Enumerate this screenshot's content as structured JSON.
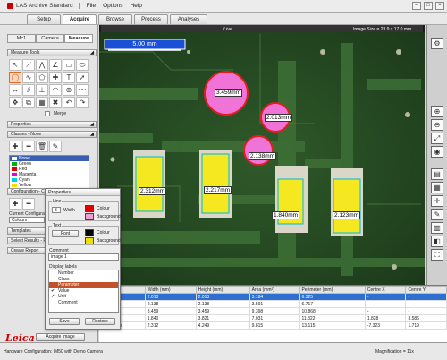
{
  "window": {
    "title": "LAS Archive Standard",
    "menu": [
      "File",
      "Options",
      "Help"
    ],
    "controls": [
      "–",
      "□",
      "×"
    ]
  },
  "tabs": [
    "Setup",
    "Acquire",
    "Browse",
    "Process",
    "Analyses"
  ],
  "active_tab": "Acquire",
  "left_panel": {
    "subtabs": [
      "Mc1",
      "Camera",
      "Measure"
    ],
    "measure_tools_title": "Measure Tools",
    "merge_label": "Merge",
    "properties_title": "Properties",
    "classes_title": "Classes - None",
    "classes": [
      {
        "name": "None",
        "color": "#ffffff"
      },
      {
        "name": "Green",
        "color": "#00b000"
      },
      {
        "name": "Red",
        "color": "#e00000"
      },
      {
        "name": "Magenta",
        "color": "#e000e0"
      },
      {
        "name": "Cyan",
        "color": "#00d0e0"
      },
      {
        "name": "Yellow",
        "color": "#f0e000"
      }
    ],
    "configuration_title": "Configuration - Colour",
    "current_configuration_label": "Current Configuration",
    "colours_label": "Colours",
    "templates_label": "Templates",
    "select_results_label": "Select Results - PCB",
    "create_report_label": "Create Report"
  },
  "properties_dialog": {
    "title": "Properties",
    "line_group": "Line",
    "width_value": "3",
    "width_label": "Width",
    "colour_label": "Colour",
    "background_label": "Background",
    "line_colour": "#e00000",
    "line_background": "#f0a0d0",
    "text_group": "Text",
    "font_button": "Font",
    "text_colour": "#000000",
    "text_background": "#f0e000",
    "comment_label": "Comment",
    "comment_value": "image 1",
    "display_labels_title": "Display labels",
    "display_labels": [
      {
        "label": "Number",
        "checked": false,
        "selected": false
      },
      {
        "label": "Class",
        "checked": false,
        "selected": false
      },
      {
        "label": "Parameter",
        "checked": false,
        "selected": true
      },
      {
        "label": "Value",
        "checked": true,
        "selected": false
      },
      {
        "label": "Unit",
        "checked": true,
        "selected": false
      },
      {
        "label": "Comment",
        "checked": false,
        "selected": false
      }
    ],
    "save_button": "Save",
    "restore_button": "Restore"
  },
  "image_view": {
    "live_label": "Live",
    "image_size": "Image Size = 23.9 x 17.0 mm",
    "scale_bar": "5.00 mm",
    "measurements": [
      "3.459mm",
      "2.013mm",
      "2.138mm",
      "2.312mm",
      "2.217mm",
      "1.840mm",
      "2.123mm"
    ]
  },
  "results_table": {
    "columns": [
      "",
      "Width (mm)",
      "Height (mm)",
      "Area (mm²)",
      "Perimeter (mm)",
      "Centre X",
      "Centre Y"
    ],
    "rows": [
      [
        "Circle",
        "2.013",
        "2.013",
        "3.184",
        "6.325",
        "-",
        "-"
      ],
      [
        "Circle",
        "2.138",
        "2.138",
        "3.591",
        "6.717",
        "-",
        "-"
      ],
      [
        "Circle",
        "3.459",
        "3.459",
        "9.398",
        "10.868",
        "-",
        "-"
      ],
      [
        "angle",
        "1.840",
        "3.821",
        "7.031",
        "11.322",
        "1.828",
        "3.586"
      ],
      [
        "Rectangle",
        "2.312",
        "4.249",
        "9.815",
        "13.115",
        "-7.323",
        "1.719"
      ]
    ],
    "selected_row": 0
  },
  "bottom": {
    "logo": "Leica",
    "acquire_button": "Acquire Image",
    "status_left": "Hardware Configuration: IM50 with Demo Camera",
    "status_right": "Magnification = 11x"
  }
}
